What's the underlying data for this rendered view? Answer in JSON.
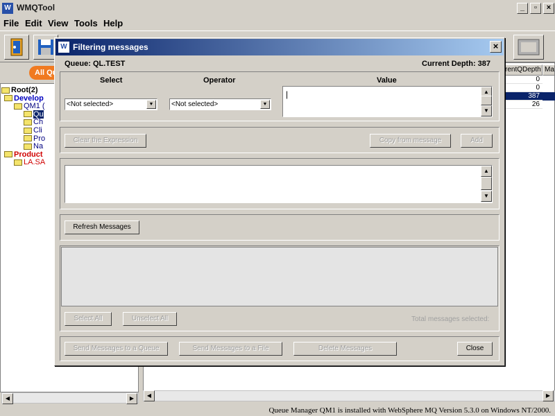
{
  "app": {
    "title": "WMQTool",
    "logo": "W",
    "window_controls": [
      "_",
      "▫",
      "×"
    ]
  },
  "menu": [
    "File",
    "Edit",
    "View",
    "Tools",
    "Help"
  ],
  "left": {
    "all_queues_tab": "All Qu",
    "tree": [
      {
        "label": "Root(2)",
        "bold": true,
        "color": "#000000"
      },
      {
        "label": "Develop",
        "bold": true,
        "color": "#0000c0"
      },
      {
        "label": "QM1 (",
        "bold": false,
        "color": "#000080"
      },
      {
        "label": "Qu",
        "bold": false,
        "color": "#000080",
        "selected": true
      },
      {
        "label": "Ch",
        "bold": false,
        "color": "#000080"
      },
      {
        "label": "Cli",
        "bold": false,
        "color": "#000080"
      },
      {
        "label": "Pro",
        "bold": false,
        "color": "#000080"
      },
      {
        "label": "Na",
        "bold": false,
        "color": "#000080"
      },
      {
        "label": "Product",
        "bold": true,
        "color": "#d00000"
      },
      {
        "label": "LA.SA",
        "bold": false,
        "color": "#d00000"
      }
    ]
  },
  "grid": {
    "headers": [
      "rentQDepth",
      "Ma"
    ],
    "rows": [
      "0",
      "0",
      "387",
      "26"
    ],
    "selected_row": 2
  },
  "dialog": {
    "title": "Filtering messages",
    "logo": "W",
    "close": "×",
    "queue_label": "Queue: QL.TEST",
    "depth_label": "Current Depth: 387",
    "col_select": "Select",
    "col_operator": "Operator",
    "col_value": "Value",
    "select_value": "<Not selected>",
    "operator_value": "<Not selected>",
    "value_text": "|",
    "clear_expression": "Clear the Expression",
    "copy_from_message": "Copy from message",
    "add": "Add",
    "refresh_messages": "Refresh Messages",
    "select_all": "Select All",
    "unselect_all": "Unselect All",
    "total_selected": "Total messages selected:",
    "send_to_queue": "Send Messages to a Queue",
    "send_to_file": "Send Messages to a File",
    "delete_messages": "Delete Messages",
    "close_button": "Close"
  },
  "status": "Queue Manager QM1 is installed with WebSphere MQ Version 5.3.0 on Windows NT/2000.",
  "colors": {
    "title_gradient_start": "#0a246a",
    "title_gradient_end": "#a6caf0",
    "selection": "#0a246a",
    "face": "#d4d0c8"
  }
}
